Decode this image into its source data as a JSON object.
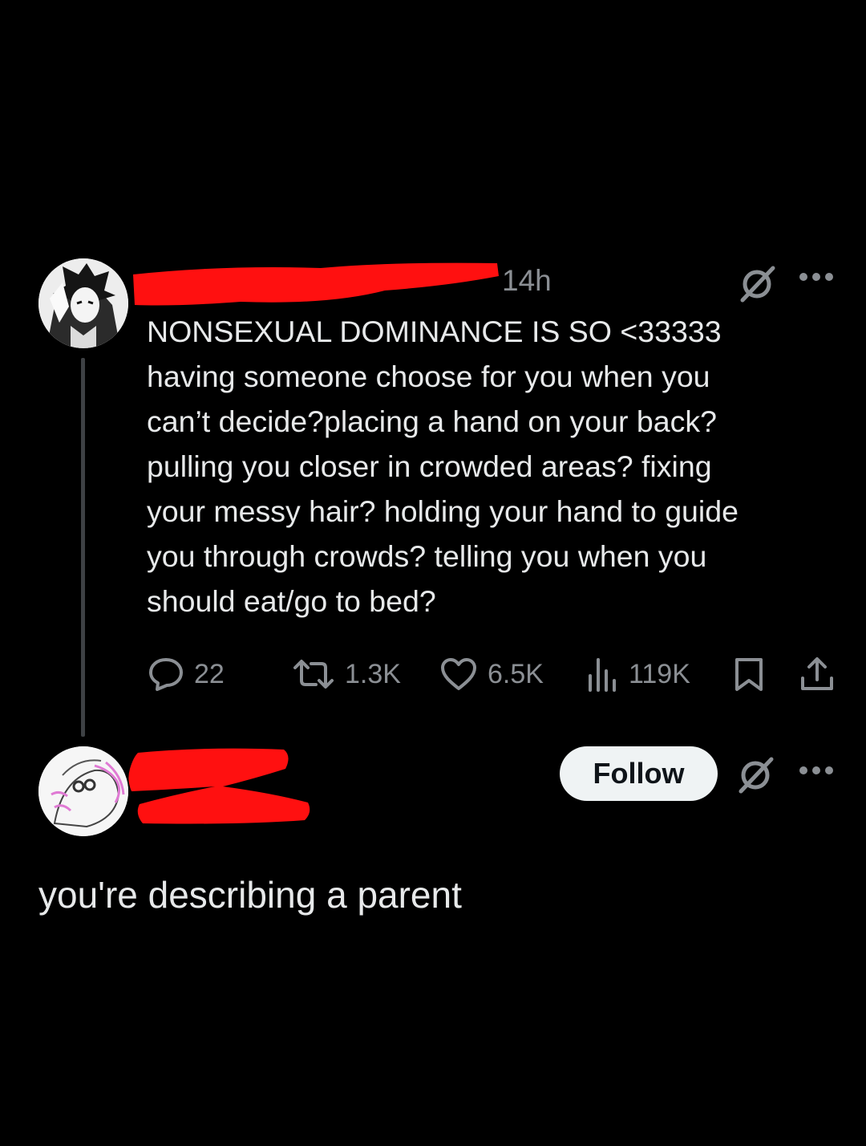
{
  "post": {
    "author_name": "",
    "timestamp": "14h",
    "text": "NONSEXUAL DOMINANCE IS SO <33333\nhaving someone choose for you when you\ncan’t decide?placing a hand on your back?\npulling you closer in crowded areas? fixing\nyour messy hair? holding your hand to guide\nyou through crowds? telling you when you\nshould eat/go to bed?",
    "stats": {
      "replies": "22",
      "reposts": "1.3K",
      "likes": "6.5K",
      "views": "119K"
    },
    "icons": [
      "grok-icon",
      "more-icon",
      "reply-icon",
      "repost-icon",
      "like-icon",
      "views-icon",
      "bookmark-icon",
      "share-icon"
    ]
  },
  "reply": {
    "follow_label": "Follow",
    "text": "you're describing a parent"
  },
  "colors": {
    "background": "#000000",
    "text": "#e7e9ea",
    "muted": "#8b8f94",
    "redaction": "#ff1010",
    "follow_bg": "#eff3f4"
  }
}
